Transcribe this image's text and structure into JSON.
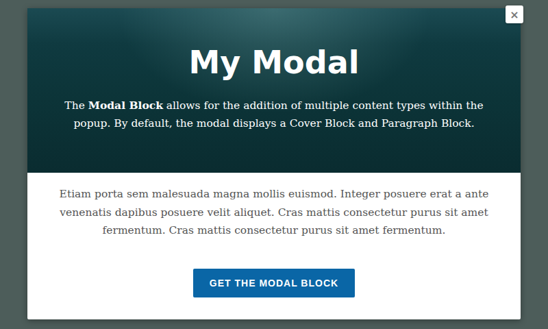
{
  "modal": {
    "title": "My Modal",
    "cover_text": [
      {
        "text": "The ",
        "bold": false
      },
      {
        "text": "Modal Block",
        "bold": true
      },
      {
        "text": " allows for the addition of multiple content types within the popup. By default, the modal displays a Cover Block and Paragraph Block.",
        "bold": false
      }
    ],
    "body_text": "Etiam porta sem malesuada magna mollis euismod. Integer posuere erat a ante venenatis dapibus posuere velit aliquet. Cras mattis consectetur purus sit amet fermentum. Cras mattis consectetur purus sit amet fermentum.",
    "button": "GET THE MODAL BLOCK",
    "close": "×"
  }
}
